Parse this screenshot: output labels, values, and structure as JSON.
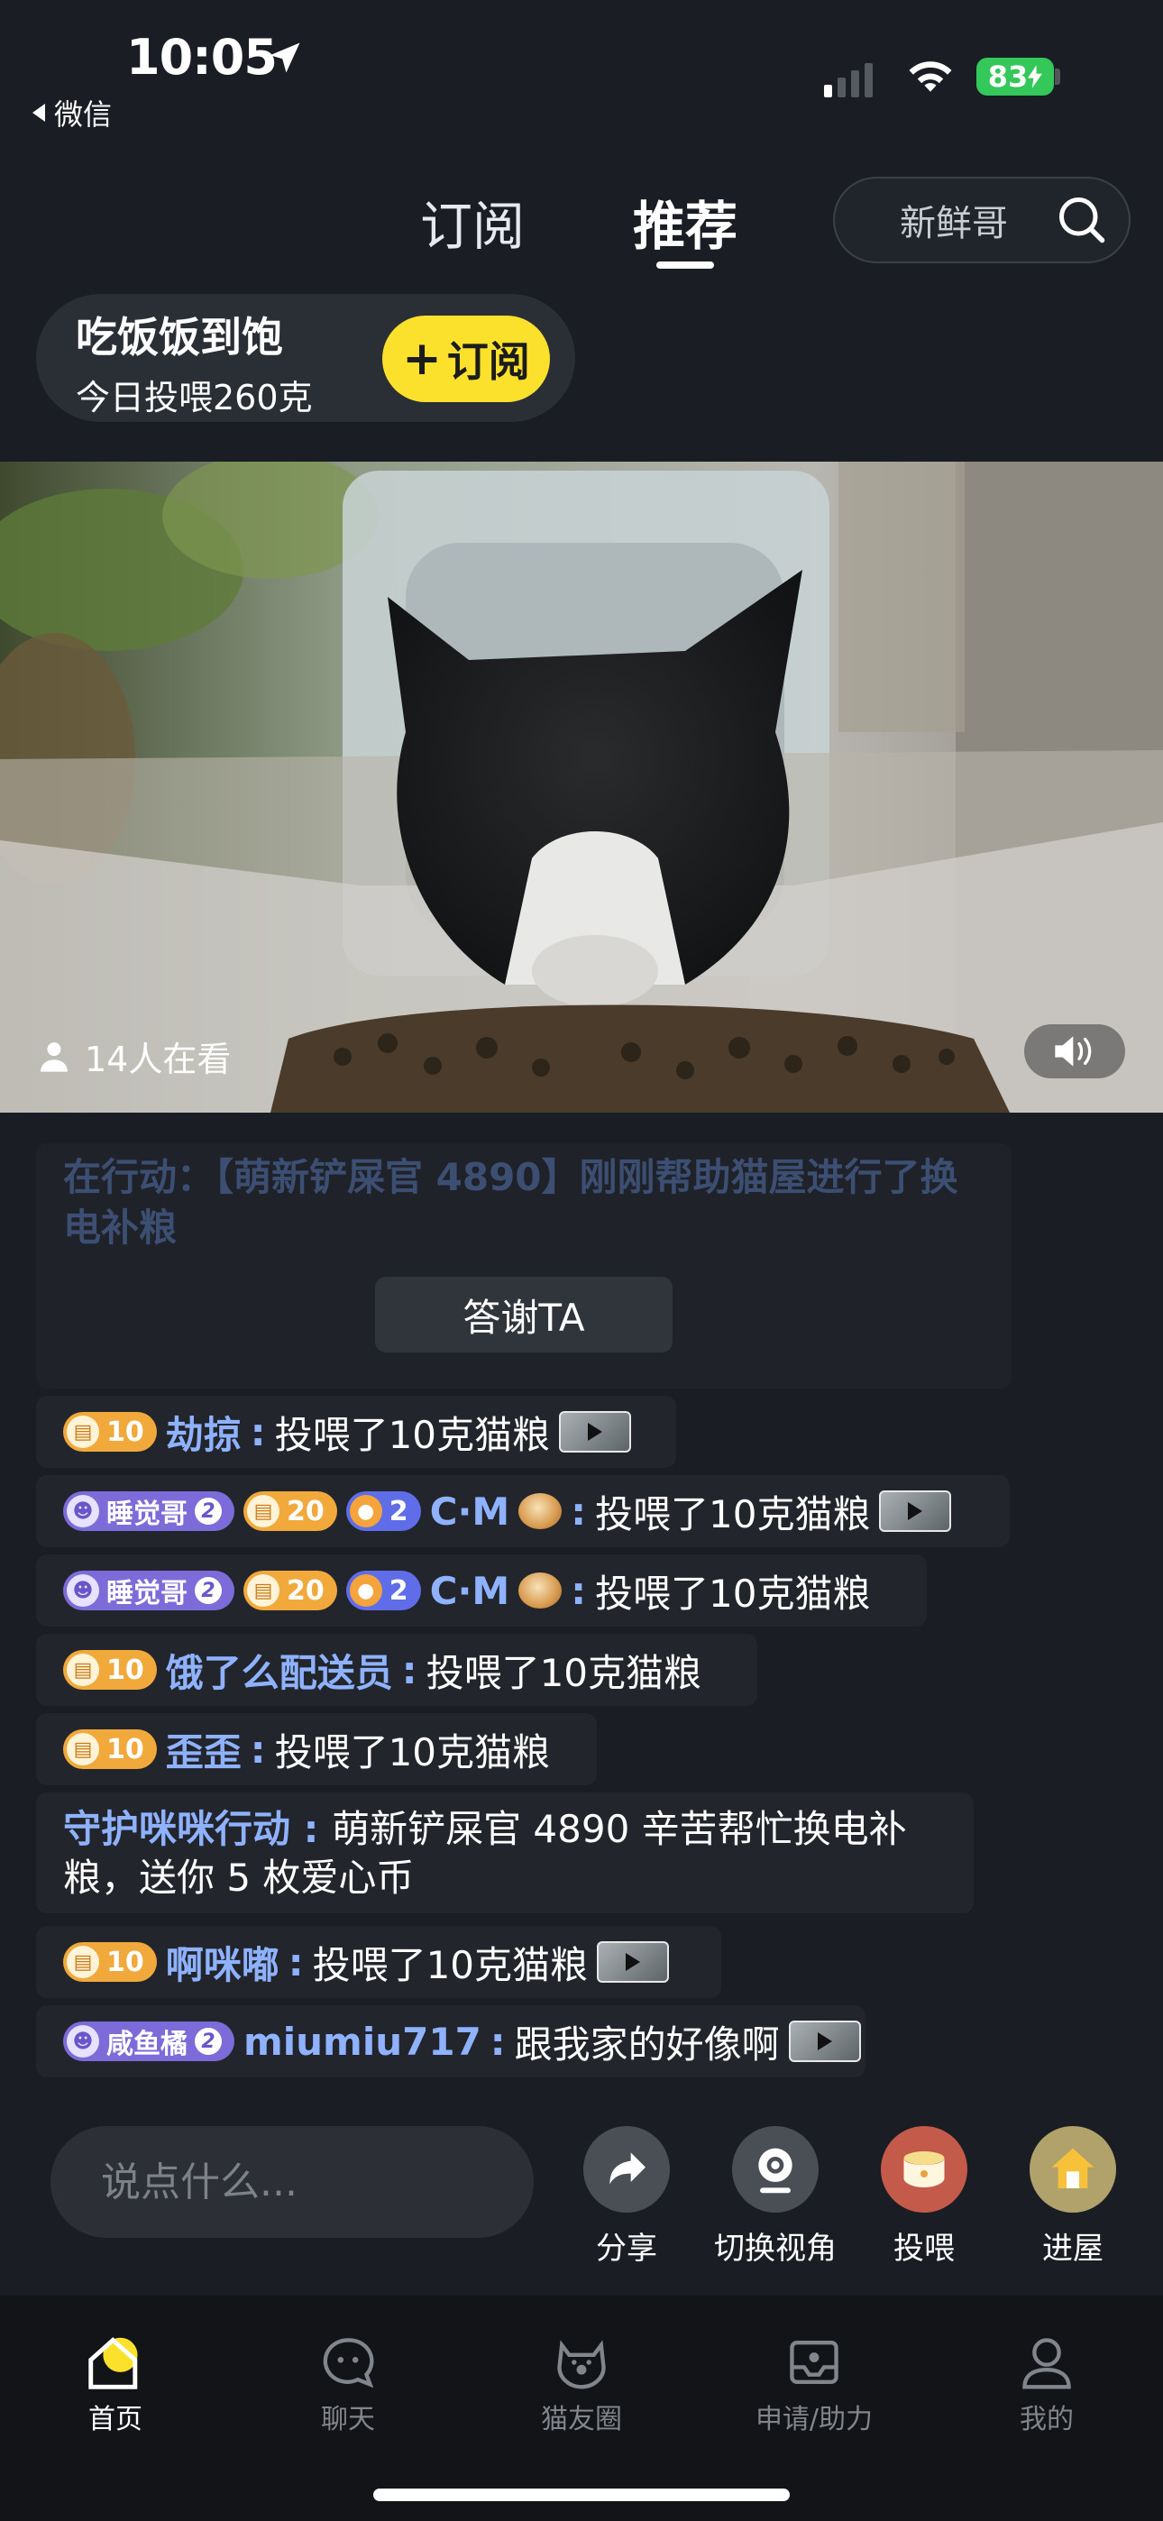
{
  "status": {
    "time": "10:05",
    "back_app": "微信",
    "battery": "83"
  },
  "tabs": {
    "subscribe": "订阅",
    "recommend": "推荐"
  },
  "search": {
    "placeholder": "新鲜哥"
  },
  "room": {
    "title": "吃饭饭到饱",
    "subtitle": "今日投喂260克",
    "subscribe_button": "订阅"
  },
  "video": {
    "viewers": "14人在看"
  },
  "notice": {
    "text": "在行动：【萌新铲屎官 4890】刚刚帮助猫屋进行了换电补粮",
    "thanks_button": "答谢TA"
  },
  "chat": [
    {
      "badges": [
        {
          "type": "food",
          "value": "10"
        }
      ],
      "name": "劫掠",
      "text": "投喂了10克猫粮",
      "video": true
    },
    {
      "badges": [
        {
          "type": "title",
          "value": "睡觉哥",
          "level": "2"
        },
        {
          "type": "food",
          "value": "20"
        },
        {
          "type": "cat",
          "value": "2"
        }
      ],
      "name": "C·M",
      "text": "投喂了10克猫粮",
      "video": true
    },
    {
      "badges": [
        {
          "type": "title",
          "value": "睡觉哥",
          "level": "2"
        },
        {
          "type": "food",
          "value": "20"
        },
        {
          "type": "cat",
          "value": "2"
        }
      ],
      "name": "C·M",
      "text": "投喂了10克猫粮",
      "video": false
    },
    {
      "badges": [
        {
          "type": "food",
          "value": "10"
        }
      ],
      "name": "饿了么配送员",
      "text": "投喂了10克猫粮",
      "video": false
    },
    {
      "badges": [
        {
          "type": "food",
          "value": "10"
        }
      ],
      "name": "歪歪",
      "text": "投喂了10克猫粮",
      "video": false
    },
    {
      "badges": [],
      "name": "守护咪咪行动",
      "text": "萌新铲屎官 4890 辛苦帮忙换电补粮，送你 5 枚爱心币",
      "video": false
    },
    {
      "badges": [
        {
          "type": "food",
          "value": "10"
        }
      ],
      "name": "啊咪嘟",
      "text": "投喂了10克猫粮",
      "video": true
    },
    {
      "badges": [
        {
          "type": "title",
          "value": "咸鱼橘",
          "level": "2"
        }
      ],
      "name": "miumiu717",
      "text": "跟我家的好像啊",
      "video": true
    }
  ],
  "composer": {
    "placeholder": "说点什么..."
  },
  "actions": {
    "share": "分享",
    "switch_view": "切换视角",
    "feed": "投喂",
    "enter_house": "进屋"
  },
  "tabbar": {
    "home": "首页",
    "chat": "聊天",
    "circle": "猫友圈",
    "apply": "申请/助力",
    "mine": "我的"
  },
  "colors": {
    "accent_yellow": "#fbe12b",
    "nickname_blue": "#8fb2ff",
    "background": "#1a1d23"
  }
}
